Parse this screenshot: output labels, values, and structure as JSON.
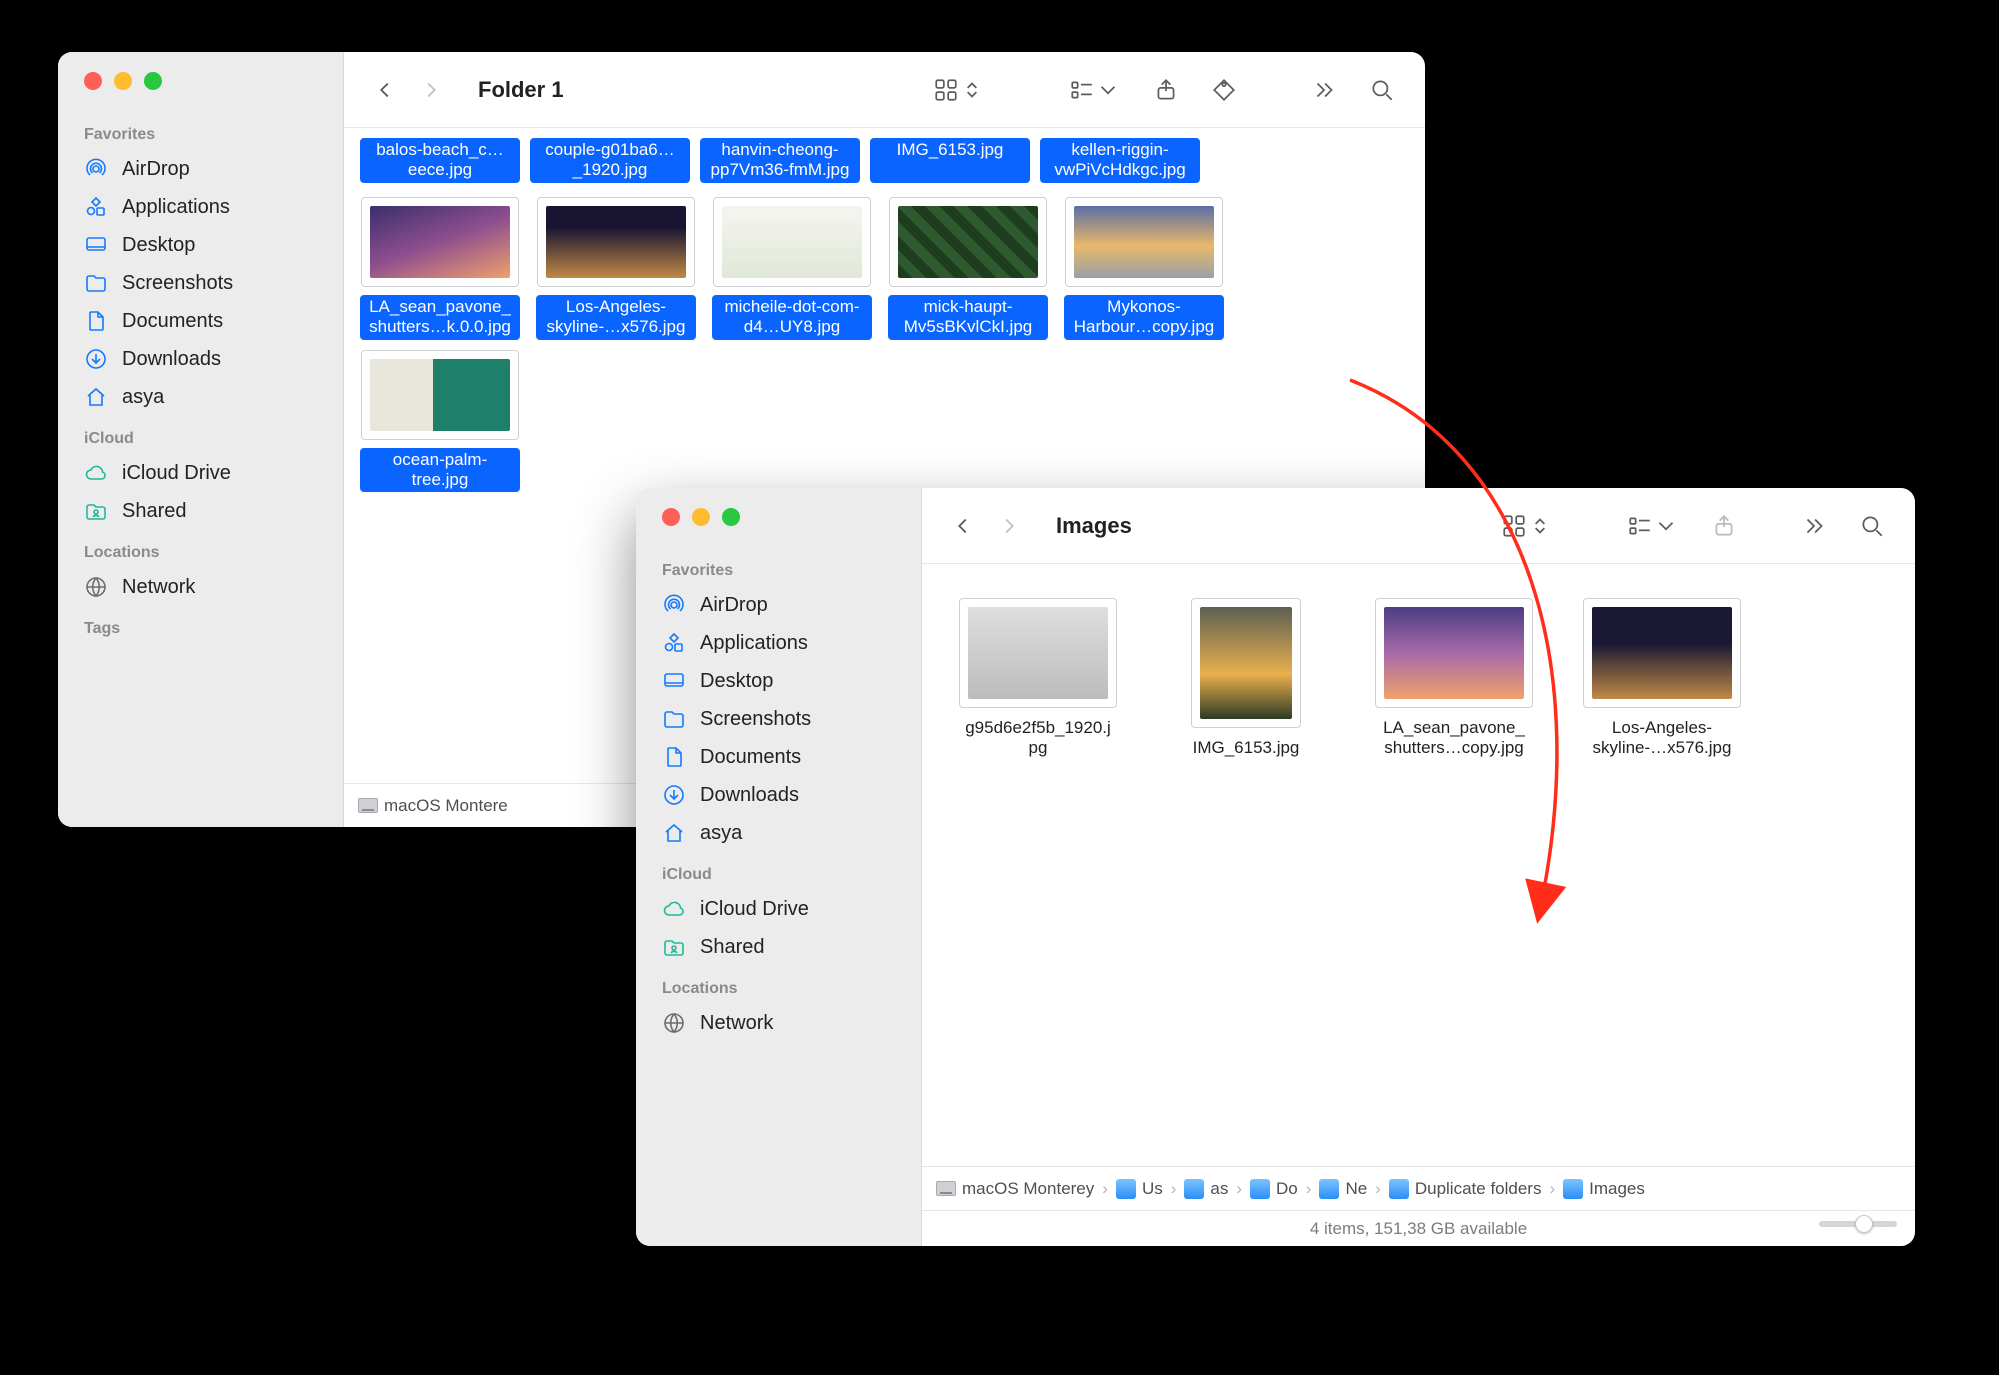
{
  "windows": {
    "w1": {
      "title": "Folder 1",
      "sidebar": {
        "s_fav": "Favorites",
        "airdrop": "AirDrop",
        "apps": "Applications",
        "desktop": "Desktop",
        "scr": "Screenshots",
        "docs": "Documents",
        "dl": "Downloads",
        "home": "asya",
        "s_icloud": "iCloud",
        "idrive": "iCloud Drive",
        "shared": "Shared",
        "s_loc": "Locations",
        "network": "Network",
        "s_tags": "Tags"
      },
      "row0": {
        "f0": "balos-beach_c…eece.jpg",
        "f1": "couple-g01ba6…_1920.jpg",
        "f2": "hanvin-cheong-pp7Vm36-fmM.jpg",
        "f3": "IMG_6153.jpg",
        "f4": "kellen-riggin-vwPiVcHdkgc.jpg"
      },
      "row1": {
        "f0": "LA_sean_pavone_shutters…k.0.0.jpg",
        "f1": "Los-Angeles-skyline-…x576.jpg",
        "f2": "micheile-dot-com-d4…UY8.jpg",
        "f3": "mick-haupt-Mv5sBKvlCkI.jpg",
        "f4": "Mykonos-Harbour…copy.jpg"
      },
      "row2": {
        "f0": "ocean-palm-tree.jpg"
      },
      "pathbar_disk": "macOS Montere"
    },
    "w2": {
      "title": "Images",
      "sidebar": {
        "s_fav": "Favorites",
        "airdrop": "AirDrop",
        "apps": "Applications",
        "desktop": "Desktop",
        "scr": "Screenshots",
        "docs": "Documents",
        "dl": "Downloads",
        "home": "asya",
        "s_icloud": "iCloud",
        "idrive": "iCloud Drive",
        "shared": "Shared",
        "s_loc": "Locations",
        "network": "Network"
      },
      "files": {
        "f0": "g95d6e2f5b_1920.jpg",
        "f1": "IMG_6153.jpg",
        "f2": "LA_sean_pavone_shutters…copy.jpg",
        "f3": "Los-Angeles-skyline-…x576.jpg"
      },
      "pathbar": {
        "p0": "macOS Monterey",
        "p1": "Us",
        "p2": "as",
        "p3": "Do",
        "p4": "Ne",
        "p5": "Duplicate folders",
        "p6": "Images"
      },
      "status": "4 items, 151,38 GB available"
    }
  }
}
